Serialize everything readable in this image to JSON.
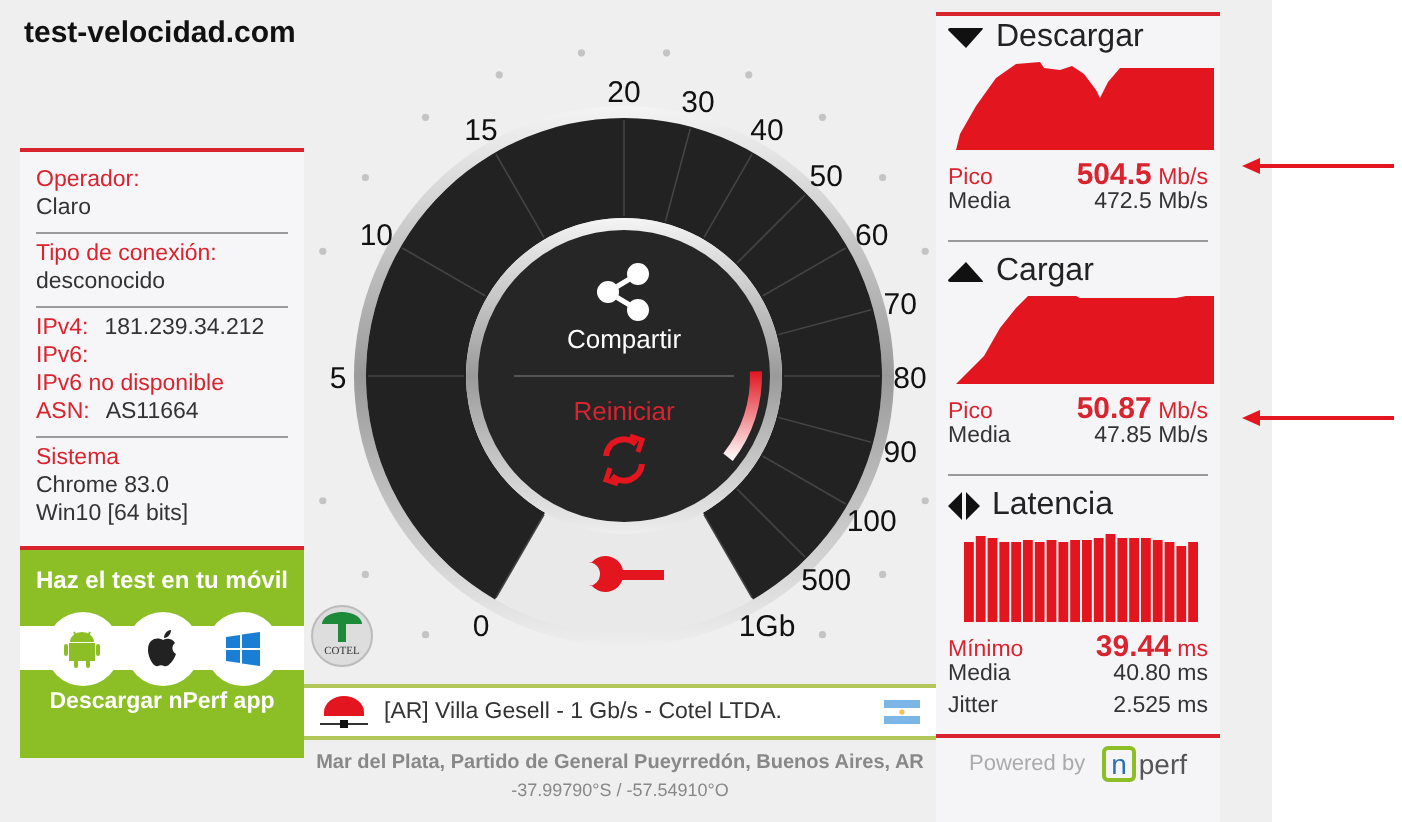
{
  "logo": "test-velocidad.com",
  "connection": {
    "sections": [
      {
        "rows": [
          {
            "kind": "stacked",
            "label": "Operador:",
            "lines": [
              "Claro"
            ],
            "alert": false
          }
        ]
      },
      {
        "rows": [
          {
            "kind": "stacked",
            "label": "Tipo de conexión:",
            "lines": [
              "desconocido"
            ],
            "alert": false
          }
        ]
      },
      {
        "rows": [
          {
            "kind": "inline",
            "label": "IPv4:",
            "lines": [
              "181.239.34.212"
            ],
            "alert": false
          },
          {
            "kind": "stacked",
            "label": "IPv6:",
            "lines": [
              "IPv6 no disponible"
            ],
            "alert": true
          },
          {
            "kind": "inline",
            "label": "ASN:",
            "lines": [
              "AS11664"
            ],
            "alert": false
          }
        ]
      },
      {
        "rows": [
          {
            "kind": "stacked",
            "label": "Sistema",
            "lines": [
              "Chrome 83.0",
              "Win10 [64 bits]"
            ],
            "alert": false
          }
        ]
      }
    ]
  },
  "mobile_promo": {
    "title": "Haz el test en tu móvil",
    "platforms": [
      {
        "kind": "android"
      },
      {
        "kind": "apple"
      },
      {
        "kind": "windows"
      }
    ],
    "button": "Descargar nPerf app"
  },
  "gauge": {
    "scale": [
      "0",
      "5",
      "10",
      "15",
      "20",
      "30",
      "40",
      "50",
      "60",
      "70",
      "80",
      "90",
      "100",
      "500",
      "1Gb"
    ],
    "share": "Compartir",
    "restart": "Reiniciar",
    "sponsor_logo": "COTEL"
  },
  "server": {
    "name": "[AR] Villa Gesell - 1 Gb/s - Cotel LTDA.",
    "location": "Mar del Plata, Partido de General Pueyrredón, Buenos Aires, AR",
    "coordinates": "-37.99790°S / -57.54910°O"
  },
  "results": [
    {
      "kind": "download",
      "title": "Descargar",
      "rows": [
        {
          "label": "Pico",
          "value": "504.5",
          "unit": "Mb/s",
          "highlight": true
        },
        {
          "label": "Media",
          "value": "472.5",
          "unit": "Mb/s",
          "highlight": false
        }
      ]
    },
    {
      "kind": "upload",
      "title": "Cargar",
      "rows": [
        {
          "label": "Pico",
          "value": "50.87",
          "unit": "Mb/s",
          "highlight": true
        },
        {
          "label": "Media",
          "value": "47.85",
          "unit": "Mb/s",
          "highlight": false
        }
      ]
    },
    {
      "kind": "latency",
      "title": "Latencia",
      "rows": [
        {
          "label": "Mínimo",
          "value": "39.44",
          "unit": "ms",
          "highlight": true
        },
        {
          "label": "Media",
          "value": "40.80",
          "unit": "ms",
          "highlight": false
        },
        {
          "label": "Jitter",
          "value": "2.525",
          "unit": "ms",
          "highlight": false
        }
      ]
    }
  ],
  "footer": {
    "powered_by": "Powered by",
    "brand_mark": "n",
    "brand_rest": "perf"
  }
}
